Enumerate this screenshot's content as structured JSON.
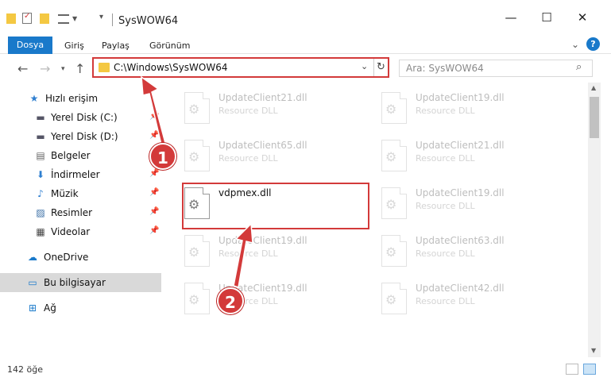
{
  "window": {
    "title": "SysWOW64",
    "controls": {
      "minimize": "—",
      "maximize": "☐",
      "close": "✕"
    }
  },
  "ribbon": {
    "tabs": [
      "Dosya",
      "Giriş",
      "Paylaş",
      "Görünüm"
    ],
    "help_label": "?"
  },
  "address_bar": {
    "path": "C:\\Windows\\SysWOW64",
    "refresh_icon": "↻",
    "dropdown_icon": "⌄"
  },
  "search": {
    "placeholder": "Ara: SysWOW64"
  },
  "sidebar": {
    "items": [
      {
        "label": "Hızlı erişim",
        "icon": "star-icon",
        "glyph": "★",
        "pinned": false,
        "selected": false
      },
      {
        "label": "Yerel Disk (C:)",
        "icon": "drive-icon",
        "glyph": "▬",
        "pinned": true,
        "selected": false
      },
      {
        "label": "Yerel Disk (D:)",
        "icon": "drive-icon",
        "glyph": "▬",
        "pinned": true,
        "selected": false
      },
      {
        "label": "Belgeler",
        "icon": "documents-icon",
        "glyph": "▤",
        "pinned": true,
        "selected": false
      },
      {
        "label": "İndirmeler",
        "icon": "download-icon",
        "glyph": "⬇",
        "pinned": true,
        "selected": false
      },
      {
        "label": "Müzik",
        "icon": "music-icon",
        "glyph": "♪",
        "pinned": true,
        "selected": false
      },
      {
        "label": "Resimler",
        "icon": "pictures-icon",
        "glyph": "▨",
        "pinned": true,
        "selected": false
      },
      {
        "label": "Videolar",
        "icon": "videos-icon",
        "glyph": "▦",
        "pinned": true,
        "selected": false
      },
      {
        "label": "OneDrive",
        "icon": "cloud-icon",
        "glyph": "☁",
        "pinned": false,
        "selected": false
      },
      {
        "label": "Bu bilgisayar",
        "icon": "computer-icon",
        "glyph": "▭",
        "pinned": false,
        "selected": true
      },
      {
        "label": "Ağ",
        "icon": "network-icon",
        "glyph": "⊞",
        "pinned": false,
        "selected": false
      }
    ]
  },
  "files": [
    {
      "name": "UpdateClient21.dll",
      "type": "Resource DLL",
      "faded": true
    },
    {
      "name": "UpdateClient19.dll",
      "type": "Resource DLL",
      "faded": true
    },
    {
      "name": "UpdateClient65.dll",
      "type": "Resource DLL",
      "faded": true
    },
    {
      "name": "UpdateClient21.dll",
      "type": "Resource DLL",
      "faded": true
    },
    {
      "name": "vdpmex.dll",
      "type": "",
      "faded": false
    },
    {
      "name": "UpdateClient19.dll",
      "type": "Resource DLL",
      "faded": true
    },
    {
      "name": "UpdateClient19.dll",
      "type": "Resource DLL",
      "faded": true
    },
    {
      "name": "UpdateClient63.dll",
      "type": "Resource DLL",
      "faded": true
    },
    {
      "name": "UpdateClient19.dll",
      "type": "Resource DLL",
      "faded": true
    },
    {
      "name": "UpdateClient42.dll",
      "type": "Resource DLL",
      "faded": true
    }
  ],
  "status": {
    "item_count": "142 öğe"
  },
  "callouts": [
    "1",
    "2"
  ],
  "colors": {
    "accent": "#1979ca",
    "highlight": "#d33a3a"
  }
}
